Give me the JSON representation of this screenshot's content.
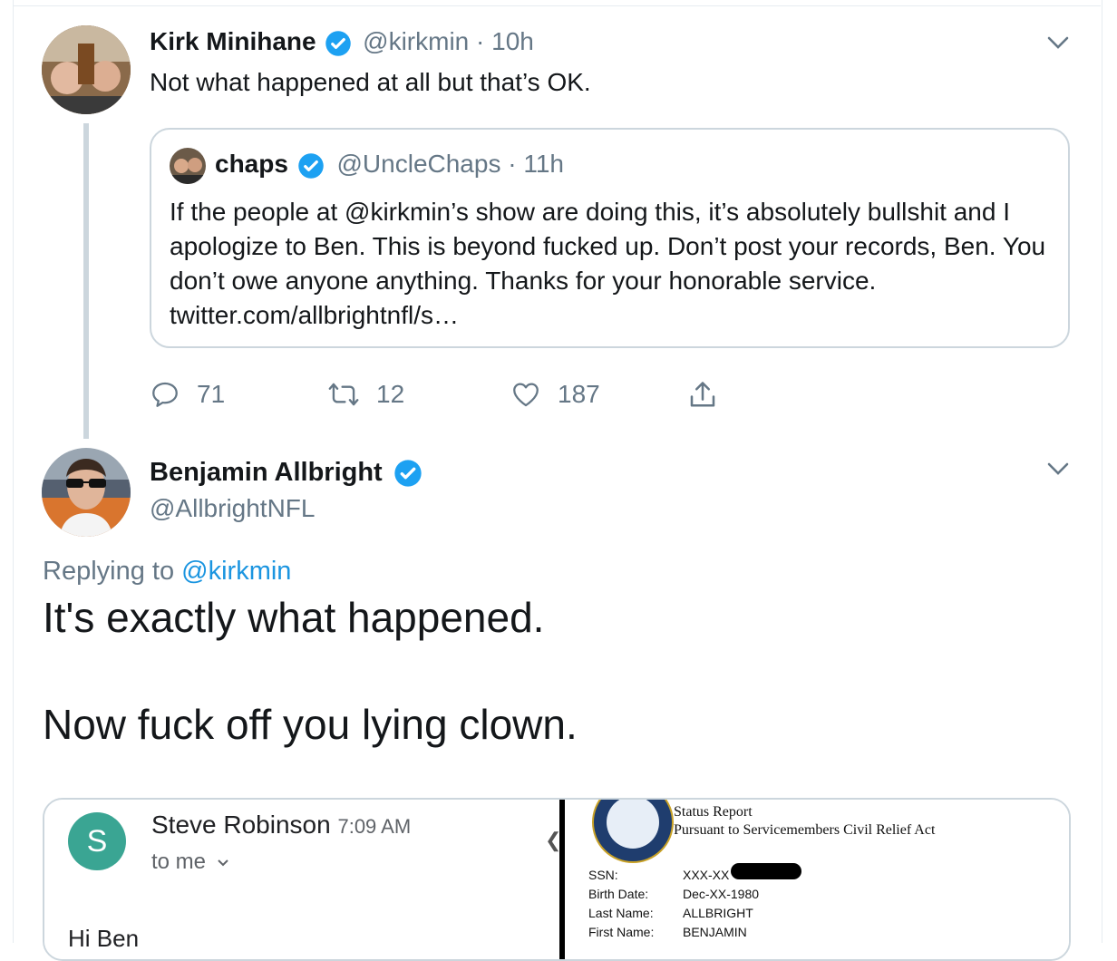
{
  "tweet1": {
    "author_name": "Kirk Minihane",
    "handle": "@kirkmin",
    "time": "10h",
    "text": "Not what happened at all but that’s OK.",
    "quote": {
      "author_name": "chaps",
      "handle": "@UncleChaps",
      "time": "11h",
      "text": "If the people at @kirkmin’s show are doing this, it’s absolutely bullshit and I apologize to Ben. This is beyond fucked up. Don’t post your records, Ben. You don’t owe anyone anything. Thanks for your honorable service. twitter.com/allbrightnfl/s…"
    },
    "actions": {
      "replies": "71",
      "retweets": "12",
      "likes": "187"
    }
  },
  "tweet2": {
    "author_name": "Benjamin Allbright",
    "handle": "@AllbrightNFL",
    "replying_prefix": "Replying to",
    "replying_to": "@kirkmin",
    "body_line1": "It's exactly what happened.",
    "body_line2": "Now fuck off you lying clown."
  },
  "media": {
    "email": {
      "avatar_letter": "S",
      "from": "Steve Robinson",
      "time": "7:09 AM",
      "to": "to me",
      "greeting": "Hi Ben"
    },
    "document": {
      "title_line1": "Status Report",
      "title_line2": "Pursuant to Servicemembers Civil Relief Act",
      "fields": [
        {
          "label": "SSN:",
          "value": "XXX-XX"
        },
        {
          "label": "Birth Date:",
          "value": "Dec-XX-1980"
        },
        {
          "label": "Last Name:",
          "value": "ALLBRIGHT"
        },
        {
          "label": "First Name:",
          "value": "BENJAMIN"
        }
      ]
    }
  },
  "colors": {
    "link": "#1b95e0",
    "muted": "#657786",
    "border": "#ccd6dd",
    "verified": "#1da1f2",
    "gmail_avatar": "#3aa593"
  },
  "icons": [
    "verified-badge-icon",
    "chevron-down-icon",
    "reply-icon",
    "retweet-icon",
    "like-icon",
    "share-icon"
  ]
}
